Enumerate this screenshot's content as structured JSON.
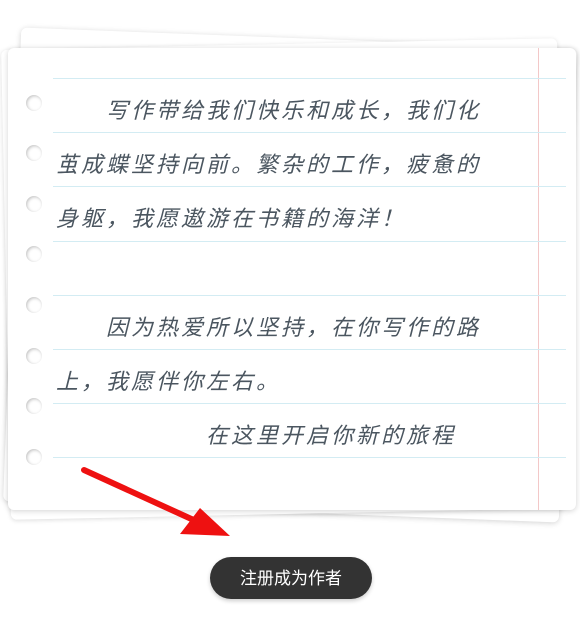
{
  "paper": {
    "lines": [
      "　　写作带给我们快乐和成长，我们化",
      "茧成蝶坚持向前。繁杂的工作，疲惫的",
      "身躯，我愿遨游在书籍的海洋！",
      "",
      "　　因为热爱所以坚持，在你写作的路",
      "上，我愿伴你左右。",
      "　　　　　　在这里开启你新的旅程"
    ]
  },
  "register_button": {
    "label": "注册成为作者"
  },
  "colors": {
    "ink": "#4b5660",
    "rule": "#d3ecf3",
    "margin": "#f3c8c8",
    "arrow": "#ee1111",
    "button_bg": "#333333"
  },
  "icons": {
    "arrow": "red-arrow-icon"
  }
}
